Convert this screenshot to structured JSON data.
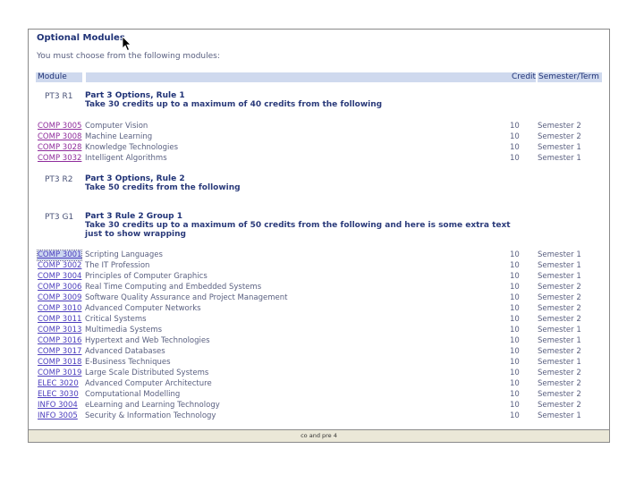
{
  "page": {
    "heading": "Optional Modules",
    "intro": "You must choose from the following modules:"
  },
  "table_header": {
    "module": "Module",
    "credit": "Credit",
    "term": "Semester/Term"
  },
  "rules": [
    {
      "code": "PT3 R1",
      "title": "Part 3 Options, Rule 1",
      "desc": "Take 30 credits up to a maximum of 40 credits from the following"
    },
    {
      "code": "PT3 R2",
      "title": "Part 3 Options, Rule 2",
      "desc": "Take 50 credits from the following"
    },
    {
      "code": "PT3 G1",
      "title": "Part 3 Rule 2 Group 1",
      "desc": "Take 30 credits up to a maximum of 50 credits from the following and here is some extra text just to show wrapping"
    }
  ],
  "group1": [
    {
      "code": "COMP 3005",
      "title": "Computer Vision",
      "credit": "10",
      "term": "Semester 2"
    },
    {
      "code": "COMP 3008",
      "title": "Machine Learning",
      "credit": "10",
      "term": "Semester 2"
    },
    {
      "code": "COMP 3028",
      "title": "Knowledge Technologies",
      "credit": "10",
      "term": "Semester 1"
    },
    {
      "code": "COMP 3032",
      "title": "Intelligent Algorithms",
      "credit": "10",
      "term": "Semester 1"
    }
  ],
  "group2": [
    {
      "code": "COMP 3001",
      "title": "Scripting Languages",
      "credit": "10",
      "term": "Semester 1"
    },
    {
      "code": "COMP 3002",
      "title": "The IT Profession",
      "credit": "10",
      "term": "Semester 1"
    },
    {
      "code": "COMP 3004",
      "title": "Principles of Computer Graphics",
      "credit": "10",
      "term": "Semester 1"
    },
    {
      "code": "COMP 3006",
      "title": "Real Time Computing and Embedded Systems",
      "credit": "10",
      "term": "Semester 2"
    },
    {
      "code": "COMP 3009",
      "title": "Software Quality Assurance and Project Management",
      "credit": "10",
      "term": "Semester 2"
    },
    {
      "code": "COMP 3010",
      "title": "Advanced Computer Networks",
      "credit": "10",
      "term": "Semester 2"
    },
    {
      "code": "COMP 3011",
      "title": "Critical Systems",
      "credit": "10",
      "term": "Semester 2"
    },
    {
      "code": "COMP 3013",
      "title": "Multimedia Systems",
      "credit": "10",
      "term": "Semester 1"
    },
    {
      "code": "COMP 3016",
      "title": "Hypertext and Web Technologies",
      "credit": "10",
      "term": "Semester 1"
    },
    {
      "code": "COMP 3017",
      "title": "Advanced Databases",
      "credit": "10",
      "term": "Semester 2"
    },
    {
      "code": "COMP 3018",
      "title": "E-Business Techniques",
      "credit": "10",
      "term": "Semester 1"
    },
    {
      "code": "COMP 3019",
      "title": "Large Scale Distributed Systems",
      "credit": "10",
      "term": "Semester 2"
    },
    {
      "code": "ELEC 3020",
      "title": "Advanced Computer Architecture",
      "credit": "10",
      "term": "Semester 2"
    },
    {
      "code": "ELEC 3030",
      "title": "Computational Modelling",
      "credit": "10",
      "term": "Semester 2"
    },
    {
      "code": "INFO 3004",
      "title": "eLearning and Learning Technology",
      "credit": "10",
      "term": "Semester 2"
    },
    {
      "code": "INFO 3005",
      "title": "Security & Information Technology",
      "credit": "10",
      "term": "Semester 1"
    }
  ],
  "status_bar": {
    "text": "co and pre 4"
  }
}
